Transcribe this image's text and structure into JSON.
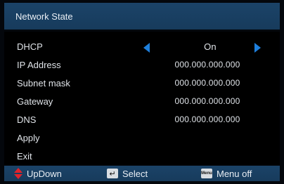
{
  "title": "Network State",
  "rows": [
    {
      "label": "DHCP",
      "value": "On"
    },
    {
      "label": "IP Address",
      "value": "000.000.000.000"
    },
    {
      "label": "Subnet mask",
      "value": "000.000.000.000"
    },
    {
      "label": "Gateway",
      "value": "000.000.000.000"
    },
    {
      "label": "DNS",
      "value": "000.000.000.000"
    },
    {
      "label": "Apply"
    },
    {
      "label": "Exit"
    }
  ],
  "footer": {
    "updown_label": "UpDown",
    "select_label": "Select",
    "select_key_glyph": "↵",
    "menu_key_glyph": "Menu",
    "menu_off_label": "Menu off"
  },
  "colors": {
    "title_bar": "#1b4368",
    "arrow": "#1e7fdc",
    "updown_icon": "#e0232b"
  }
}
